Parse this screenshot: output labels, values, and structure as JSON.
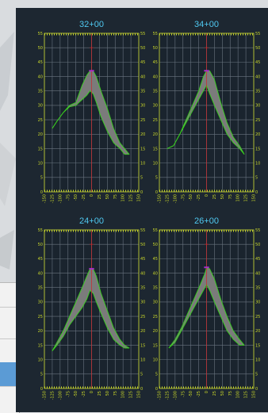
{
  "colors": {
    "window_bg": "#1d2731",
    "frame": "#c8d62a",
    "title": "#4fc8f0",
    "grid": "#6a7480",
    "band_fill": "#7b7b7b",
    "outline": "#39d11e",
    "crosshair": "#d0282a",
    "peak": "#a830c8"
  },
  "chart_data": [
    {
      "type": "area",
      "title": "32+00",
      "ylim": [
        0,
        55
      ],
      "yticks": [
        0,
        5,
        10,
        15,
        20,
        25,
        30,
        35,
        40,
        45,
        50,
        55
      ],
      "xlim": [
        -150,
        150
      ],
      "xtick_labels": [
        "-150",
        "-125",
        "-100",
        "-75",
        "-50",
        "-25",
        "0",
        "25",
        "50",
        "75",
        "100",
        "125",
        "150"
      ],
      "band": {
        "x": [
          -125,
          -110,
          -90,
          -70,
          -50,
          -30,
          -15,
          -5,
          5,
          15,
          30,
          50,
          70,
          90,
          105,
          120
        ],
        "upper": [
          22,
          24.5,
          27.5,
          30,
          31,
          37,
          40.5,
          42,
          42,
          40,
          35,
          29,
          22,
          17,
          15,
          13
        ],
        "lower": [
          22,
          24.5,
          27.5,
          29.5,
          30,
          32,
          33.5,
          35,
          34,
          31,
          26,
          21,
          17,
          15,
          13,
          13
        ]
      }
    },
    {
      "type": "area",
      "title": "34+00",
      "ylim": [
        0,
        55
      ],
      "yticks": [
        0,
        5,
        10,
        15,
        20,
        25,
        30,
        35,
        40,
        45,
        50,
        55
      ],
      "xlim": [
        -150,
        150
      ],
      "xtick_labels": [
        "-150",
        "-125",
        "-100",
        "-75",
        "-50",
        "-25",
        "0",
        "25",
        "50",
        "75",
        "100",
        "125",
        "150"
      ],
      "band": {
        "x": [
          -125,
          -105,
          -85,
          -65,
          -45,
          -25,
          -10,
          0,
          10,
          25,
          45,
          65,
          85,
          105,
          120
        ],
        "upper": [
          15,
          16,
          20,
          25,
          30,
          35,
          40,
          42,
          42,
          39,
          31,
          24,
          19,
          16,
          13
        ],
        "lower": [
          15,
          16,
          20,
          24,
          28,
          32,
          35,
          37,
          34,
          30,
          25,
          20,
          17,
          15,
          13
        ]
      }
    },
    {
      "type": "area",
      "title": "24+00",
      "ylim": [
        0,
        55
      ],
      "yticks": [
        0,
        5,
        10,
        15,
        20,
        25,
        30,
        35,
        40,
        45,
        50,
        55
      ],
      "xlim": [
        -150,
        150
      ],
      "xtick_labels": [
        "-150",
        "-125",
        "-100",
        "-75",
        "-50",
        "-25",
        "0",
        "25",
        "50",
        "75",
        "100",
        "125",
        "150"
      ],
      "band": {
        "x": [
          -125,
          -110,
          -90,
          -70,
          -50,
          -30,
          -15,
          -5,
          5,
          15,
          30,
          50,
          70,
          90,
          105,
          120
        ],
        "upper": [
          13,
          16,
          20,
          25,
          30,
          35,
          39,
          41.5,
          41.5,
          39,
          33,
          27,
          21,
          17,
          15,
          14
        ],
        "lower": [
          13,
          15,
          18,
          22,
          25,
          28,
          31,
          34,
          33,
          30,
          26,
          21,
          17,
          15,
          14,
          14
        ]
      }
    },
    {
      "type": "area",
      "title": "26+00",
      "ylim": [
        0,
        55
      ],
      "yticks": [
        0,
        5,
        10,
        15,
        20,
        25,
        30,
        35,
        40,
        45,
        50,
        55
      ],
      "xlim": [
        -150,
        150
      ],
      "xtick_labels": [
        "-150",
        "-125",
        "-100",
        "-75",
        "-50",
        "-25",
        "0",
        "25",
        "50",
        "75",
        "100",
        "125",
        "150"
      ],
      "band": {
        "x": [
          -120,
          -100,
          -80,
          -60,
          -40,
          -20,
          -5,
          0,
          10,
          25,
          45,
          65,
          85,
          105,
          120
        ],
        "upper": [
          14,
          17,
          21,
          26,
          31,
          36,
          40,
          42,
          41.5,
          38,
          31,
          25,
          20,
          17,
          15
        ],
        "lower": [
          14,
          16,
          20,
          24,
          28,
          32,
          35,
          36,
          34,
          30,
          25,
          20,
          17,
          15,
          15
        ]
      }
    }
  ]
}
